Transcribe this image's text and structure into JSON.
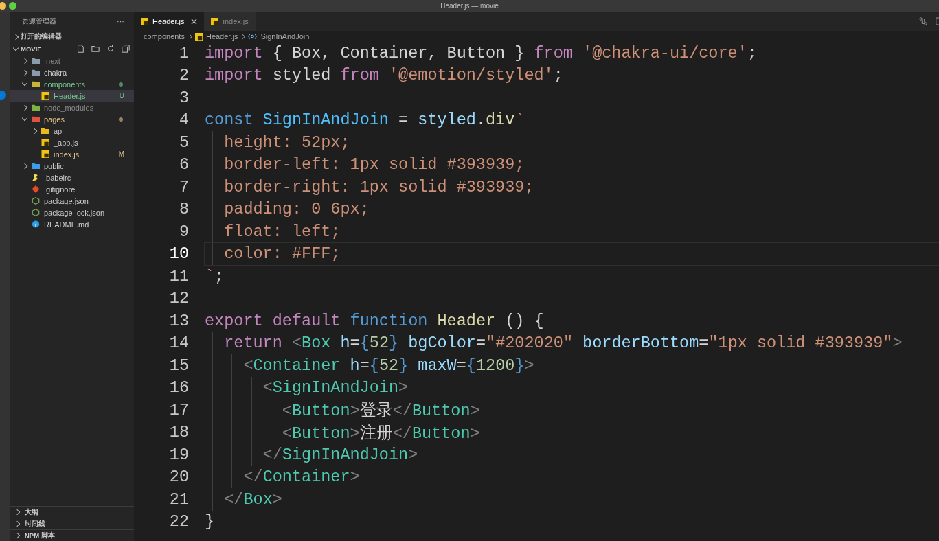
{
  "window": {
    "title": "Header.js — movie"
  },
  "sidebar": {
    "title": "资源管理器",
    "more": "···",
    "open_editors": "打开的编辑器",
    "project": "MOVIE",
    "tree": [
      {
        "name": ".next",
        "kind": "folder",
        "color": "#8c8c8c",
        "dot": false,
        "expanded": false,
        "selected": false
      },
      {
        "name": "chakra",
        "kind": "folder",
        "dot": false,
        "expanded": false,
        "selected": false
      },
      {
        "name": "components",
        "kind": "compfolder",
        "color": "#73c991",
        "dot": true,
        "expanded": true,
        "selected": false,
        "children": [
          {
            "name": "Header.js",
            "kind": "js",
            "color": "#73c991",
            "badge": "U",
            "selected": true
          }
        ]
      },
      {
        "name": "node_modules",
        "kind": "libfolder",
        "color": "#8c8c8c",
        "dot": false,
        "expanded": false,
        "selected": false
      },
      {
        "name": "pages",
        "kind": "pagesfolder",
        "color": "#e2c08d",
        "dot": true,
        "expanded": true,
        "selected": false,
        "children": [
          {
            "name": "api",
            "kind": "apifolder",
            "dot": false,
            "expanded": false,
            "selected": false
          },
          {
            "name": "_app.js",
            "kind": "js",
            "selected": false
          },
          {
            "name": "index.js",
            "kind": "js",
            "color": "#e2c08d",
            "badge": "M",
            "selected": false
          }
        ]
      },
      {
        "name": "public",
        "kind": "publicfolder",
        "dot": false,
        "expanded": false,
        "selected": false
      },
      {
        "name": ".babelrc",
        "kind": "babel",
        "selected": false
      },
      {
        "name": ".gitignore",
        "kind": "git",
        "selected": false
      },
      {
        "name": "package.json",
        "kind": "json",
        "selected": false
      },
      {
        "name": "package-lock.json",
        "kind": "json",
        "selected": false
      },
      {
        "name": "README.md",
        "kind": "info",
        "selected": false
      }
    ],
    "sections": [
      "大纲",
      "时间线",
      "NPM 脚本"
    ]
  },
  "tabs": [
    {
      "label": "Header.js",
      "selected": true
    },
    {
      "label": "index.js",
      "selected": false
    }
  ],
  "breadcrumb": [
    "components",
    "Header.js",
    "SignInAndJoin"
  ],
  "code": [
    {
      "number": "1",
      "current": false,
      "tokens": [
        {
          "kind": "kw",
          "text": "import"
        },
        {
          "kind": "plain",
          "text": " { Box, Container, Button } "
        },
        {
          "kind": "kw",
          "text": "from"
        },
        {
          "kind": "str",
          "text": " '@chakra-ui/core'"
        },
        {
          "kind": "plain",
          "text": ";"
        }
      ]
    },
    {
      "number": "2",
      "current": false,
      "tokens": [
        {
          "kind": "kw",
          "text": "import"
        },
        {
          "kind": "plain",
          "text": " styled "
        },
        {
          "kind": "kw",
          "text": "from"
        },
        {
          "kind": "str",
          "text": " '@emotion/styled'"
        },
        {
          "kind": "plain",
          "text": ";"
        }
      ]
    },
    {
      "number": "3",
      "current": false
    },
    {
      "number": "4",
      "current": false,
      "tokens": [
        {
          "kind": "storage",
          "text": "const"
        },
        {
          "kind": "const",
          "text": " SignInAndJoin"
        },
        {
          "kind": "plain",
          "text": " ="
        },
        {
          "kind": "var",
          "text": " styled"
        },
        {
          "kind": "plain",
          "text": "."
        },
        {
          "kind": "fn",
          "text": "div"
        },
        {
          "kind": "str",
          "text": "`"
        }
      ]
    },
    {
      "number": "5",
      "current": false,
      "tokens": [
        {
          "kind": "str",
          "text": "  height: 52px;"
        }
      ]
    },
    {
      "number": "6",
      "current": false,
      "tokens": [
        {
          "kind": "str",
          "text": "  border-left: 1px solid #393939;"
        }
      ]
    },
    {
      "number": "7",
      "current": false,
      "tokens": [
        {
          "kind": "str",
          "text": "  border-right: 1px solid #393939;"
        }
      ]
    },
    {
      "number": "8",
      "current": false,
      "tokens": [
        {
          "kind": "str",
          "text": "  padding: 0 6px;"
        }
      ]
    },
    {
      "number": "9",
      "current": false,
      "tokens": [
        {
          "kind": "str",
          "text": "  float: left;"
        }
      ]
    },
    {
      "number": "10",
      "current": true,
      "tokens": [
        {
          "kind": "str",
          "text": "  color: #FFF;"
        }
      ]
    },
    {
      "number": "11",
      "current": false,
      "tokens": [
        {
          "kind": "str",
          "text": "`"
        },
        {
          "kind": "plain",
          "text": ";"
        }
      ]
    },
    {
      "number": "12",
      "current": false
    },
    {
      "number": "13",
      "current": false,
      "tokens": [
        {
          "kind": "kw",
          "text": "export"
        },
        {
          "kind": "kw",
          "text": " default"
        },
        {
          "kind": "storage",
          "text": " function"
        },
        {
          "kind": "fn",
          "text": " Header"
        },
        {
          "kind": "plain",
          "text": " () {"
        }
      ]
    },
    {
      "number": "14",
      "current": false,
      "tokens": [
        {
          "kind": "kw",
          "text": "  return"
        },
        {
          "kind": "punc",
          "text": " <"
        },
        {
          "kind": "tag",
          "text": "Box"
        },
        {
          "kind": "attr",
          "text": " h"
        },
        {
          "kind": "plain",
          "text": "="
        },
        {
          "kind": "brace",
          "text": "{"
        },
        {
          "kind": "num",
          "text": "52"
        },
        {
          "kind": "brace",
          "text": "}"
        },
        {
          "kind": "attr",
          "text": " bgColor"
        },
        {
          "kind": "plain",
          "text": "="
        },
        {
          "kind": "str",
          "text": "\"#202020\""
        },
        {
          "kind": "attr",
          "text": " borderBottom"
        },
        {
          "kind": "plain",
          "text": "="
        },
        {
          "kind": "str",
          "text": "\"1px solid #393939\""
        },
        {
          "kind": "punc",
          "text": ">"
        }
      ]
    },
    {
      "number": "15",
      "current": false,
      "tokens": [
        {
          "kind": "punc",
          "text": "    <"
        },
        {
          "kind": "tag",
          "text": "Container"
        },
        {
          "kind": "attr",
          "text": " h"
        },
        {
          "kind": "plain",
          "text": "="
        },
        {
          "kind": "brace",
          "text": "{"
        },
        {
          "kind": "num",
          "text": "52"
        },
        {
          "kind": "brace",
          "text": "}"
        },
        {
          "kind": "attr",
          "text": " maxW"
        },
        {
          "kind": "plain",
          "text": "="
        },
        {
          "kind": "brace",
          "text": "{"
        },
        {
          "kind": "num",
          "text": "1200"
        },
        {
          "kind": "brace",
          "text": "}"
        },
        {
          "kind": "punc",
          "text": ">"
        }
      ]
    },
    {
      "number": "16",
      "current": false,
      "tokens": [
        {
          "kind": "punc",
          "text": "      <"
        },
        {
          "kind": "tag",
          "text": "SignInAndJoin"
        },
        {
          "kind": "punc",
          "text": ">"
        }
      ]
    },
    {
      "number": "17",
      "current": false,
      "tokens": [
        {
          "kind": "punc",
          "text": "        <"
        },
        {
          "kind": "tag",
          "text": "Button"
        },
        {
          "kind": "punc",
          "text": ">"
        },
        {
          "kind": "plain",
          "text": "登录"
        },
        {
          "kind": "punc",
          "text": "</"
        },
        {
          "kind": "tag",
          "text": "Button"
        },
        {
          "kind": "punc",
          "text": ">"
        }
      ]
    },
    {
      "number": "18",
      "current": false,
      "tokens": [
        {
          "kind": "punc",
          "text": "        <"
        },
        {
          "kind": "tag",
          "text": "Button"
        },
        {
          "kind": "punc",
          "text": ">"
        },
        {
          "kind": "plain",
          "text": "注册"
        },
        {
          "kind": "punc",
          "text": "</"
        },
        {
          "kind": "tag",
          "text": "Button"
        },
        {
          "kind": "punc",
          "text": ">"
        }
      ]
    },
    {
      "number": "19",
      "current": false,
      "tokens": [
        {
          "kind": "punc",
          "text": "      </"
        },
        {
          "kind": "tag",
          "text": "SignInAndJoin"
        },
        {
          "kind": "punc",
          "text": ">"
        }
      ]
    },
    {
      "number": "20",
      "current": false,
      "tokens": [
        {
          "kind": "punc",
          "text": "    </"
        },
        {
          "kind": "tag",
          "text": "Container"
        },
        {
          "kind": "punc",
          "text": ">"
        }
      ]
    },
    {
      "number": "21",
      "current": false,
      "tokens": [
        {
          "kind": "punc",
          "text": "  </"
        },
        {
          "kind": "tag",
          "text": "Box"
        },
        {
          "kind": "punc",
          "text": ">"
        }
      ]
    },
    {
      "number": "22",
      "current": false,
      "tokens": [
        {
          "kind": "plain",
          "text": "}"
        }
      ]
    }
  ]
}
